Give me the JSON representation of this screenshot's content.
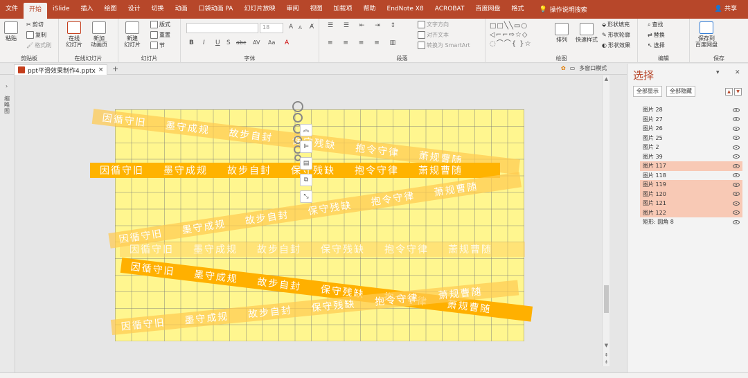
{
  "menu": {
    "tabs": [
      "文件",
      "开始",
      "iSlide",
      "插入",
      "绘图",
      "设计",
      "切换",
      "动画",
      "口袋动画 PA",
      "幻灯片放映",
      "审阅",
      "视图",
      "加载项",
      "帮助",
      "EndNote X8",
      "ACROBAT",
      "百度网盘",
      "格式"
    ],
    "active_index": 1,
    "tell_me": "操作说明搜索",
    "share": "共享"
  },
  "ribbon": {
    "clipboard": {
      "paste": "粘贴",
      "cut": "剪切",
      "copy": "复制",
      "format_painter": "格式刷",
      "label": "剪贴板"
    },
    "online": {
      "online_slide": "在线\n幻灯片",
      "new_anim": "新加\n动画页",
      "label": "在线幻灯片",
      "hot": "HOT"
    },
    "slides": {
      "new_slide": "新建\n幻灯片",
      "layout": "版式",
      "reset": "重置",
      "section": "节",
      "label": "幻灯片"
    },
    "font": {
      "font_size": "18",
      "label": "字体",
      "bold": "B",
      "italic": "I",
      "underline": "U",
      "strike": "S",
      "abc": "abc",
      "av": "AV",
      "aa": "Aa",
      "grow": "A",
      "shrink": "A"
    },
    "paragraph": {
      "text_dir": "文字方向",
      "align_text": "对齐文本",
      "smartart": "转换为 SmartArt",
      "label": "段落"
    },
    "drawing": {
      "arrange": "排列",
      "quick_styles": "快速样式",
      "fill": "形状填充",
      "outline": "形状轮廓",
      "effects": "形状效果",
      "label": "绘图"
    },
    "editing": {
      "find": "查找",
      "replace": "替换",
      "select": "选择",
      "label": "编辑"
    },
    "save": {
      "save_baidu": "保存到\n百度网盘",
      "label": "保存"
    }
  },
  "file_tab": {
    "name": "ppt平滑效果制作4.pptx"
  },
  "left_pane": {
    "label": "缩略图"
  },
  "view": {
    "multiwindow": "多窗口模式"
  },
  "bands": [
    {
      "words": [
        "因循守旧",
        "墨守成规",
        "故步自封",
        "保守残缺",
        "抱令守律",
        "萧规曹随"
      ],
      "style": "light"
    },
    {
      "words": [
        "因循守旧",
        "墨守成规",
        "故步自封",
        "保守残缺",
        "抱令守律",
        "萧规曹随"
      ],
      "style": "solid"
    },
    {
      "words": [
        "因循守旧",
        "墨守成规",
        "故步自封",
        "保守残缺",
        "抱令守律",
        "萧规曹随"
      ],
      "style": "light"
    },
    {
      "words": [
        "因循守旧",
        "墨守成规",
        "故步自封",
        "保守残缺",
        "抱令守律",
        "萧规曹随"
      ],
      "style": "faint"
    },
    {
      "words": [
        "因循守旧",
        "墨守成规",
        "故步自封",
        "保守残缺",
        "抱令守律",
        "萧规曹随"
      ],
      "style": "dark"
    },
    {
      "words": [
        "因循守旧",
        "墨守成规",
        "故步自封",
        "保守残缺",
        "抱令守律",
        "萧规曹随"
      ],
      "style": "light"
    }
  ],
  "selection_pane": {
    "title": "选择",
    "show_all": "全部显示",
    "hide_all": "全部隐藏",
    "items": [
      {
        "name": "图片 28",
        "selected": false
      },
      {
        "name": "图片 27",
        "selected": false
      },
      {
        "name": "图片 26",
        "selected": false
      },
      {
        "name": "图片 25",
        "selected": false
      },
      {
        "name": "图片 2",
        "selected": false
      },
      {
        "name": "图片 39",
        "selected": false
      },
      {
        "name": "图片 117",
        "selected": true
      },
      {
        "name": "图片 118",
        "selected": false
      },
      {
        "name": "图片 119",
        "selected": true
      },
      {
        "name": "图片 120",
        "selected": true
      },
      {
        "name": "图片 121",
        "selected": true
      },
      {
        "name": "图片 122",
        "selected": true
      },
      {
        "name": "矩形: 圆角 8",
        "selected": false
      }
    ]
  },
  "colors": {
    "accent": "#b7472a",
    "slide_bg": "#fff68f",
    "band": "#ffb300",
    "selected_row": "#f8c9b5"
  }
}
